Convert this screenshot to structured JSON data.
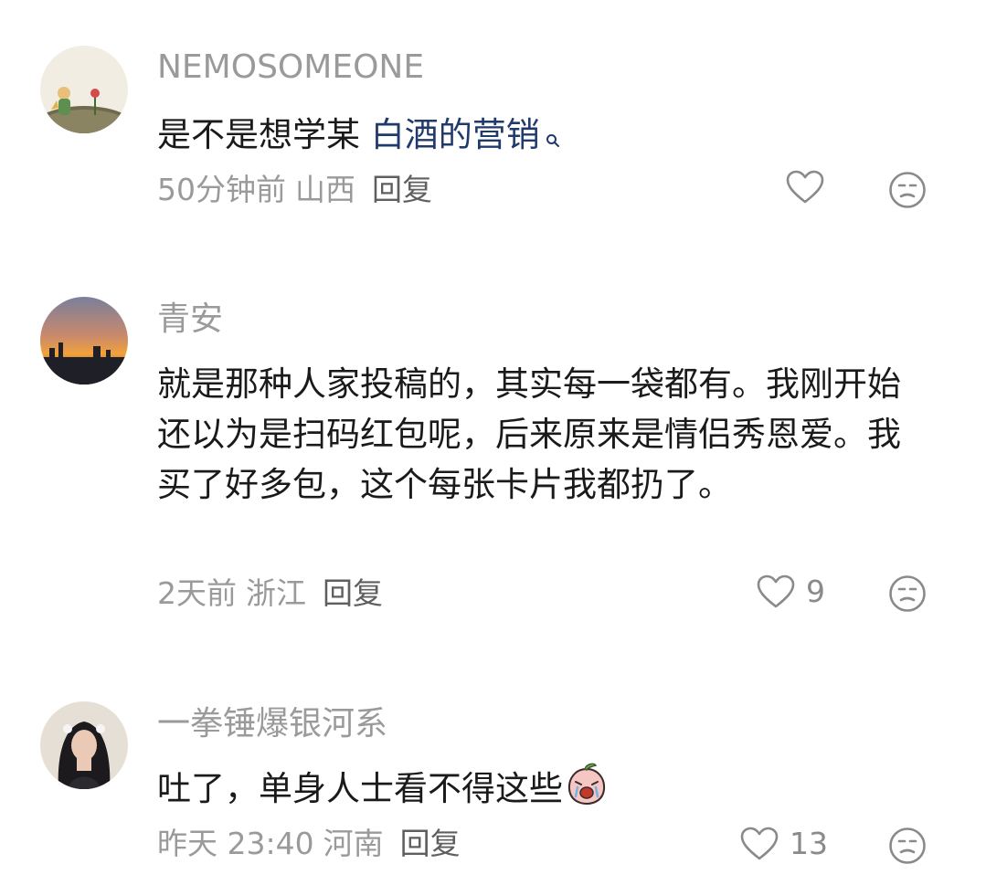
{
  "comments": [
    {
      "username": "NEMOSOMEONE",
      "text_before": "是不是想学某 ",
      "keyword": "白酒的营销",
      "text_after": "",
      "time": "50分钟前",
      "location": "山西",
      "reply_label": "回复",
      "likes": "",
      "avatar_icon": "little-prince-avatar"
    },
    {
      "username": "青安",
      "text_before": "就是那种人家投稿的，其实每一袋都有。我刚开始还以为是扫码红包呢，后来原来是情侣秀恩爱。我买了好多包，这个每张卡片我都扔了。",
      "keyword": "",
      "text_after": "",
      "time": "2天前",
      "location": "浙江",
      "reply_label": "回复",
      "likes": "9",
      "avatar_icon": "sunset-avatar"
    },
    {
      "username": "一拳锤爆银河系",
      "text_before": "吐了，单身人士看不得这些",
      "keyword": "",
      "text_after": "",
      "time": "昨天 23:40",
      "location": "河南",
      "reply_label": "回复",
      "likes": "13",
      "avatar_icon": "girl-portrait-avatar",
      "emoji": "crying-peach-emoji"
    }
  ],
  "colors": {
    "keyword": "#1f3a6b",
    "meta": "#9a9a9a",
    "text": "#1a1a1a"
  }
}
